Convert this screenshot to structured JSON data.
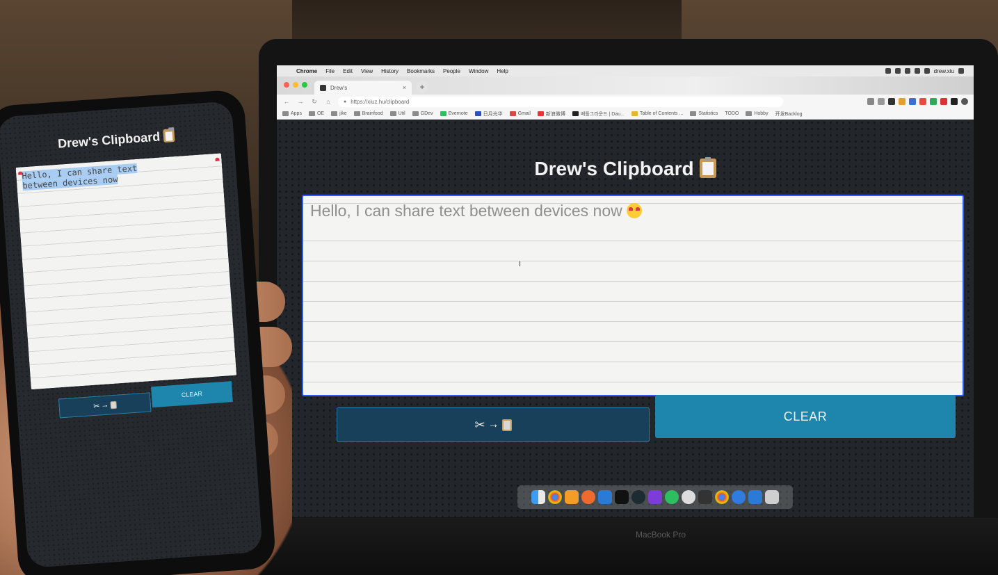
{
  "menubar": {
    "app": "Chrome",
    "items": [
      "File",
      "Edit",
      "View",
      "History",
      "Bookmarks",
      "People",
      "Window",
      "Help"
    ],
    "username": "drew.xiu"
  },
  "browser": {
    "tab_title": "Drew's",
    "url": "https://xiuz.hu/clipboard",
    "bookmarks": [
      "Apps",
      "OE",
      "jike",
      "Brainfood",
      "Util",
      "GDev",
      "Evernote",
      "日月光华",
      "Gmail",
      "新浪微博",
      "배틀그라운드 | Dau...",
      "Table of Contents ...",
      "Statistics",
      "TODO",
      "Hobby",
      "开发Backlog"
    ]
  },
  "app": {
    "title": "Drew's Clipboard",
    "text_value": "Hello, I can share text between devices now",
    "copy_arrow": "→",
    "clear_label": "CLEAR"
  },
  "laptop": {
    "brand_label": "MacBook Pro"
  },
  "phone": {
    "title": "Drew's Clipboard",
    "text_line1": "Hello, I can share text",
    "text_line2": "between devices now",
    "copy_arrow": "→",
    "clear_label": "CLEAR"
  },
  "colors": {
    "page_bg": "#23272b",
    "focus_border": "#2e5bff",
    "copy_button_bg": "#18405a",
    "clear_button_bg": "#1e85ad"
  },
  "icons": {
    "dock": [
      "finder-icon",
      "chrome-icon",
      "sublime-icon",
      "safari-icon",
      "vscode-icon",
      "terminal-icon",
      "gitkraken-icon",
      "postman-icon",
      "evernote-icon",
      "activity-icon",
      "xdx-icon",
      "chrome-icon",
      "safari-icon",
      "vscode-icon",
      "trash-icon"
    ]
  }
}
